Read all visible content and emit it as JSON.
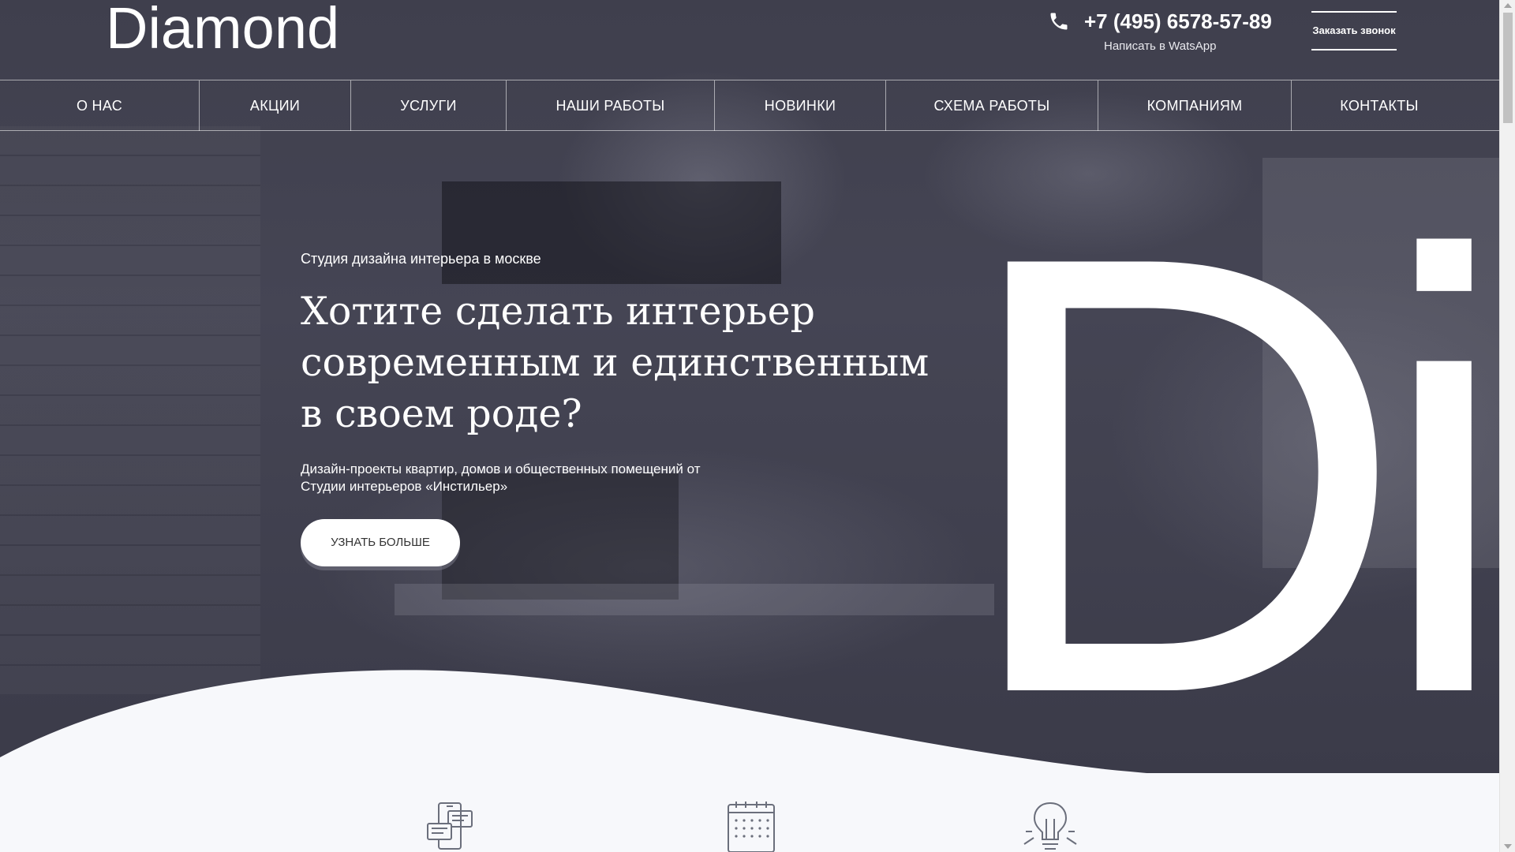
{
  "header": {
    "logo": "Diamond",
    "phone": "+7 (495) 6578-57-89",
    "whatsapp_label": "Написать в WatsApp",
    "callback_label": "Заказать звонок",
    "phone_icon": "phone-icon"
  },
  "nav": {
    "items": [
      {
        "label": "О НАС"
      },
      {
        "label": "АКЦИИ"
      },
      {
        "label": "УСЛУГИ"
      },
      {
        "label": "НАШИ РАБОТЫ"
      },
      {
        "label": "НОВИНКИ"
      },
      {
        "label": "СХЕМА РАБОТЫ"
      },
      {
        "label": "КОМПАНИЯМ"
      },
      {
        "label": "КОНТАКТЫ"
      }
    ]
  },
  "hero": {
    "subtitle": "Студия дизайна интерьера в москве",
    "title": "Хотите сделать интерьер современным и единственным в своем роде?",
    "description": "Дизайн-проекты квартир, домов и общественных помещений от Студии интерьеров «Инстильер»",
    "button_label": "УЗНАТЬ БОЛЬШЕ",
    "big_letters": "Di"
  },
  "features": {
    "icons": [
      "chat-icon",
      "calendar-icon",
      "lightbulb-icon"
    ]
  },
  "colors": {
    "hero_overlay": "#414150",
    "accent": "#ffffff",
    "page_bg": "#f7f8fb",
    "icon_stroke": "#6b6f7c"
  }
}
